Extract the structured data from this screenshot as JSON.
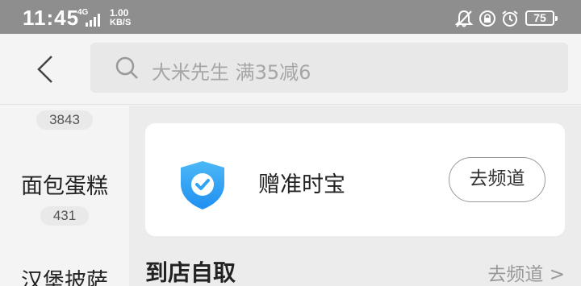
{
  "status_bar": {
    "time": "11:45",
    "network": "4G",
    "speed_value": "1.00",
    "speed_unit": "KB/S",
    "battery": "75",
    "icons": [
      "mute-icon",
      "rotation-lock-icon",
      "alarm-icon"
    ]
  },
  "header": {
    "search_placeholder": "大米先生 满35减6"
  },
  "sidebar": {
    "items": [
      {
        "label": "",
        "count": "3843"
      },
      {
        "label": "面包蛋糕",
        "count": "431"
      },
      {
        "label": "汉堡披萨",
        "count": ""
      }
    ]
  },
  "main": {
    "channel": {
      "icon": "shield-check-icon",
      "title": "赠准时宝",
      "button": "去频道"
    },
    "section": {
      "title": "到店自取",
      "link": "去频道 >"
    }
  },
  "colors": {
    "status_bar_bg": "#8e8e8e",
    "shield_blue": "#2fa4f4",
    "page_bg": "#f4f4f4"
  }
}
